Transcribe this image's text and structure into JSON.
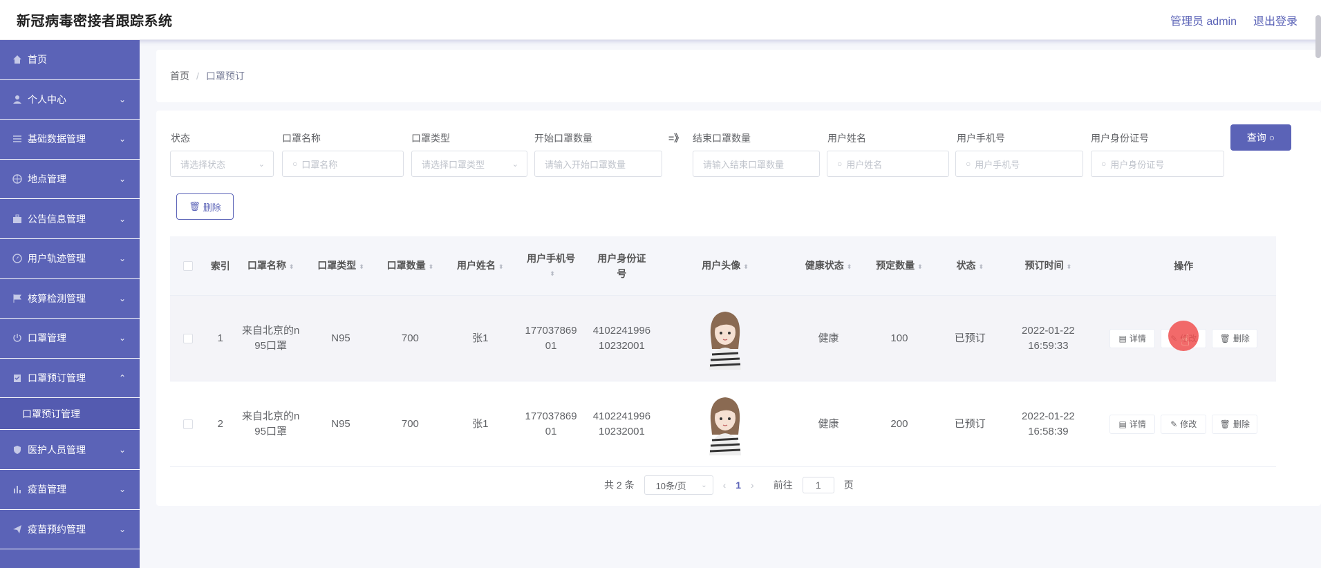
{
  "header": {
    "title": "新冠病毒密接者跟踪系统",
    "user": "管理员 admin",
    "logout": "退出登录"
  },
  "sidebar": {
    "items": [
      {
        "label": "首页",
        "icon": "home-icon",
        "expandable": false
      },
      {
        "label": "个人中心",
        "icon": "user-icon",
        "expandable": true
      },
      {
        "label": "基础数据管理",
        "icon": "sliders-icon",
        "expandable": true
      },
      {
        "label": "地点管理",
        "icon": "globe-icon",
        "expandable": true
      },
      {
        "label": "公告信息管理",
        "icon": "briefcase-icon",
        "expandable": true
      },
      {
        "label": "用户轨迹管理",
        "icon": "compass-icon",
        "expandable": true
      },
      {
        "label": "核算检测管理",
        "icon": "flag-icon",
        "expandable": true
      },
      {
        "label": "口罩管理",
        "icon": "power-icon",
        "expandable": true
      },
      {
        "label": "口罩预订管理",
        "icon": "clipboard-icon",
        "expandable": true,
        "expanded": true
      },
      {
        "label": "医护人员管理",
        "icon": "shield-icon",
        "expandable": true
      },
      {
        "label": "疫苗管理",
        "icon": "bar-chart-icon",
        "expandable": true
      },
      {
        "label": "疫苗预约管理",
        "icon": "send-icon",
        "expandable": true
      }
    ],
    "sub_item": "口罩预订管理"
  },
  "breadcrumb": {
    "home": "首页",
    "sep": "/",
    "current": "口罩预订"
  },
  "filters": {
    "status_label": "状态",
    "status_placeholder": "请选择状态",
    "mask_name_label": "口罩名称",
    "mask_name_placeholder": "口罩名称",
    "mask_type_label": "口罩类型",
    "mask_type_placeholder": "请选择口罩类型",
    "start_qty_label": "开始口罩数量",
    "start_qty_placeholder": "请输入开始口罩数量",
    "arrow": "=》",
    "end_qty_label": "结束口罩数量",
    "end_qty_placeholder": "请输入结束口罩数量",
    "user_name_label": "用户姓名",
    "user_name_placeholder": "用户姓名",
    "user_phone_label": "用户手机号",
    "user_phone_placeholder": "用户手机号",
    "user_id_label": "用户身份证号",
    "user_id_placeholder": "用户身份证号",
    "query_button": "查询"
  },
  "actions": {
    "delete_button": "删除"
  },
  "table": {
    "headers": [
      "索引",
      "口罩名称",
      "口罩类型",
      "口罩数量",
      "用户姓名",
      "用户手机号",
      "用户身份证号",
      "用户头像",
      "健康状态",
      "预定数量",
      "状态",
      "预订时间",
      "操作"
    ],
    "rows": [
      {
        "index": "1",
        "mask_name": "来自北京的n95口罩",
        "mask_type": "N95",
        "mask_qty": "700",
        "user_name": "张1",
        "phone": "17703786901",
        "id_card": "410224199610232001",
        "health": "健康",
        "reserved_qty": "100",
        "status": "已预订",
        "time_date": "2022-01-22",
        "time_clock": "16:59:33"
      },
      {
        "index": "2",
        "mask_name": "来自北京的n95口罩",
        "mask_type": "N95",
        "mask_qty": "700",
        "user_name": "张1",
        "phone": "17703786901",
        "id_card": "410224199610232001",
        "health": "健康",
        "reserved_qty": "200",
        "status": "已预订",
        "time_date": "2022-01-22",
        "time_clock": "16:58:39"
      }
    ],
    "op_detail": "详情",
    "op_edit": "修改",
    "op_delete": "删除"
  },
  "pagination": {
    "total": "共 2 条",
    "page_size": "10条/页",
    "current_page": "1",
    "goto_prefix": "前往",
    "goto_value": "1",
    "goto_suffix": "页"
  },
  "colors": {
    "accent": "#5b63b7",
    "sidebar": "#5b63b7"
  }
}
